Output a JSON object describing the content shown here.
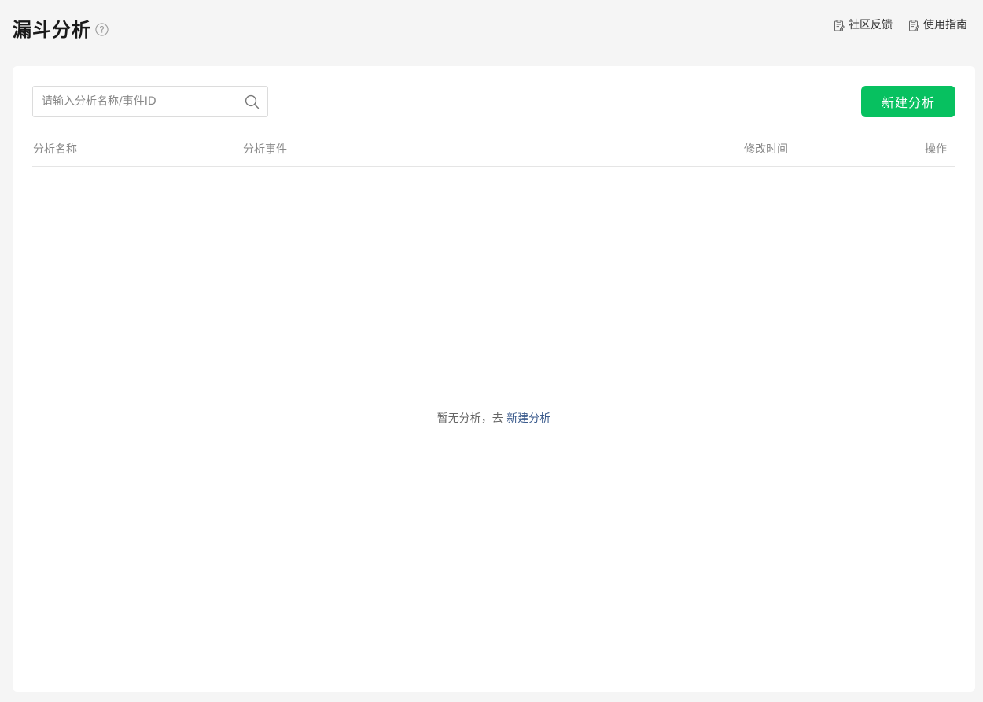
{
  "header": {
    "title": "漏斗分析",
    "help_icon": "question-circle-icon",
    "links": [
      {
        "label": "社区反馈",
        "icon": "clipboard-edit-icon"
      },
      {
        "label": "使用指南",
        "icon": "clipboard-edit-icon"
      }
    ]
  },
  "toolbar": {
    "search_placeholder": "请输入分析名称/事件ID",
    "search_value": "",
    "search_icon": "search-icon",
    "new_button_label": "新建分析"
  },
  "table": {
    "columns": [
      "分析名称",
      "分析事件",
      "修改时间",
      "操作"
    ],
    "rows": []
  },
  "empty_state": {
    "text": "暂无分析，去",
    "link_label": "新建分析"
  },
  "colors": {
    "accent": "#07c160",
    "link": "#3a5a8c",
    "background": "#f5f5f5"
  }
}
